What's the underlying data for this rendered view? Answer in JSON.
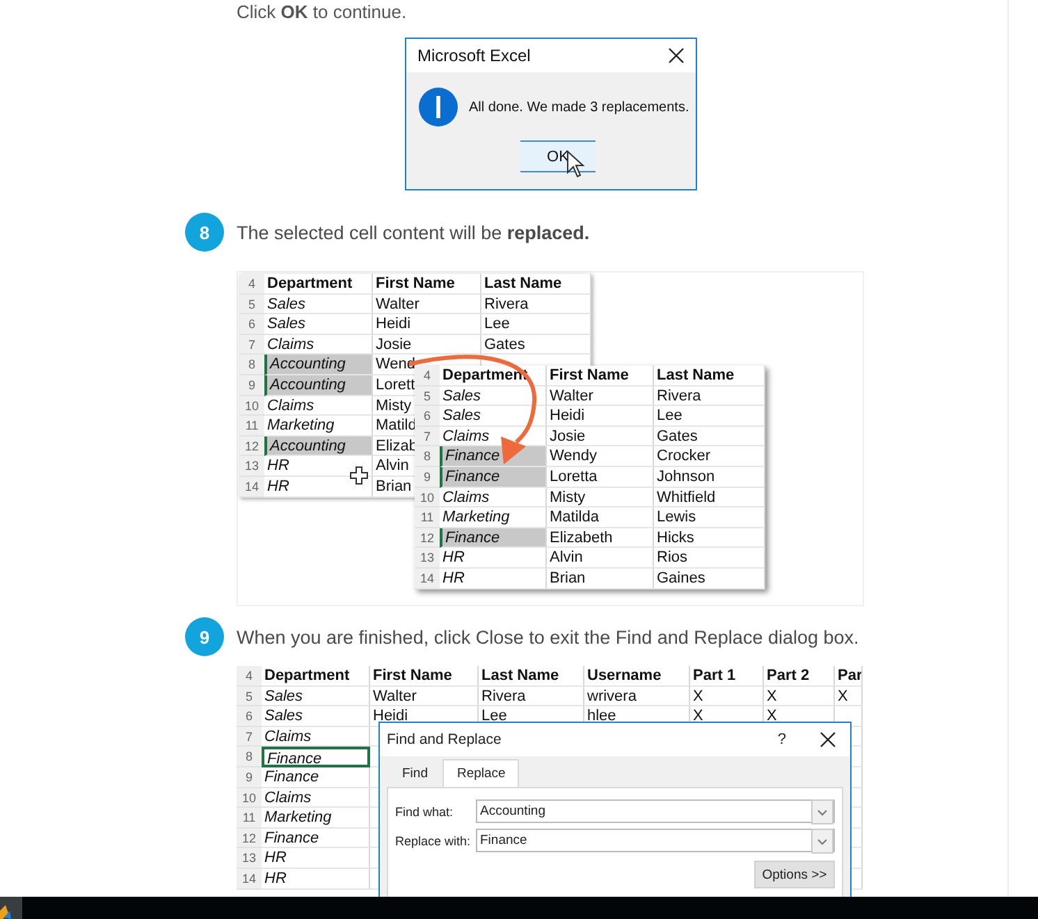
{
  "intro": {
    "text": "Click **OK** to continue."
  },
  "message_dialog": {
    "title": "Microsoft Excel",
    "message": "All done. We made 3 replacements.",
    "button": "OK"
  },
  "steps": [
    {
      "number": "8",
      "text": "The selected cell content will be **replaced.**",
      "figure": {
        "kind": "before_after",
        "sheets": [
          {
            "columns": [
              "Department",
              "First Name",
              "Last Name"
            ],
            "header_row": "4",
            "rows": [
              {
                "row": "5",
                "cells": [
                  "Sales",
                  "Walter",
                  "Rivera"
                ],
                "selected": false
              },
              {
                "row": "6",
                "cells": [
                  "Sales",
                  "Heidi",
                  "Lee"
                ],
                "selected": false
              },
              {
                "row": "7",
                "cells": [
                  "Claims",
                  "Josie",
                  "Gates"
                ],
                "selected": false
              },
              {
                "row": "8",
                "cells": [
                  "Accounting",
                  "Wend"
                ],
                "selected": true
              },
              {
                "row": "9",
                "cells": [
                  "Accounting",
                  "Lorett"
                ],
                "selected": true
              },
              {
                "row": "10",
                "cells": [
                  "Claims",
                  "Misty"
                ],
                "selected": false
              },
              {
                "row": "11",
                "cells": [
                  "Marketing",
                  "Matild"
                ],
                "selected": false
              },
              {
                "row": "12",
                "cells": [
                  "Accounting",
                  "Elizab"
                ],
                "selected": true
              },
              {
                "row": "13",
                "cells": [
                  "HR",
                  "Alvin"
                ],
                "selected": false
              },
              {
                "row": "14",
                "cells": [
                  "HR",
                  "Brian"
                ],
                "selected": false
              }
            ]
          },
          {
            "columns": [
              "Department",
              "First Name",
              "Last Name"
            ],
            "header_row": "4",
            "rows": [
              {
                "row": "5",
                "cells": [
                  "Sales",
                  "Walter",
                  "Rivera"
                ],
                "selected": false
              },
              {
                "row": "6",
                "cells": [
                  "Sales",
                  "Heidi",
                  "Lee"
                ],
                "selected": false
              },
              {
                "row": "7",
                "cells": [
                  "Claims",
                  "Josie",
                  "Gates"
                ],
                "selected": false
              },
              {
                "row": "8",
                "cells": [
                  "Finance",
                  "Wendy",
                  "Crocker"
                ],
                "selected": true
              },
              {
                "row": "9",
                "cells": [
                  "Finance",
                  "Loretta",
                  "Johnson"
                ],
                "selected": true
              },
              {
                "row": "10",
                "cells": [
                  "Claims",
                  "Misty",
                  "Whitfield"
                ],
                "selected": false
              },
              {
                "row": "11",
                "cells": [
                  "Marketing",
                  "Matilda",
                  "Lewis"
                ],
                "selected": false
              },
              {
                "row": "12",
                "cells": [
                  "Finance",
                  "Elizabeth",
                  "Hicks"
                ],
                "selected": true
              },
              {
                "row": "13",
                "cells": [
                  "HR",
                  "Alvin",
                  "Rios"
                ],
                "selected": false
              },
              {
                "row": "14",
                "cells": [
                  "HR",
                  "Brian",
                  "Gaines"
                ],
                "selected": false
              }
            ]
          }
        ]
      }
    },
    {
      "number": "9",
      "text": "When you are finished, click Close to exit the Find and Replace dialog box.",
      "figure": {
        "kind": "sheet_with_dialog",
        "sheets": [
          {
            "columns": [
              "Department",
              "First Name",
              "Last Name",
              "Username",
              "Part 1",
              "Part 2",
              "Par"
            ],
            "header_row": "4",
            "rows": [
              {
                "row": "5",
                "cells": [
                  "Sales",
                  "Walter",
                  "Rivera",
                  "wrivera",
                  "X",
                  "X",
                  "X"
                ],
                "active": false
              },
              {
                "row": "6",
                "cells": [
                  "Sales",
                  "Heidi",
                  "Lee",
                  "hlee",
                  "X",
                  "X"
                ],
                "active": false
              },
              {
                "row": "7",
                "cells": [
                  "Claims"
                ],
                "active": false
              },
              {
                "row": "8",
                "cells": [
                  "Finance"
                ],
                "active": true
              },
              {
                "row": "9",
                "cells": [
                  "Finance"
                ],
                "active": false
              },
              {
                "row": "10",
                "cells": [
                  "Claims"
                ],
                "active": false
              },
              {
                "row": "11",
                "cells": [
                  "Marketing"
                ],
                "active": false
              },
              {
                "row": "12",
                "cells": [
                  "Finance"
                ],
                "active": false
              },
              {
                "row": "13",
                "cells": [
                  "HR"
                ],
                "active": false
              },
              {
                "row": "14",
                "cells": [
                  "HR"
                ],
                "active": false
              }
            ]
          }
        ],
        "dialog": {
          "title": "Find and Replace",
          "help": "?",
          "tabs": [
            {
              "label": "Find",
              "selected": false
            },
            {
              "label": "Replace",
              "selected": true
            }
          ],
          "fields": [
            {
              "label": "Find what:",
              "value": "Accounting"
            },
            {
              "label": "Replace with:",
              "value": "Finance"
            }
          ],
          "button": "Options >>"
        }
      }
    }
  ]
}
